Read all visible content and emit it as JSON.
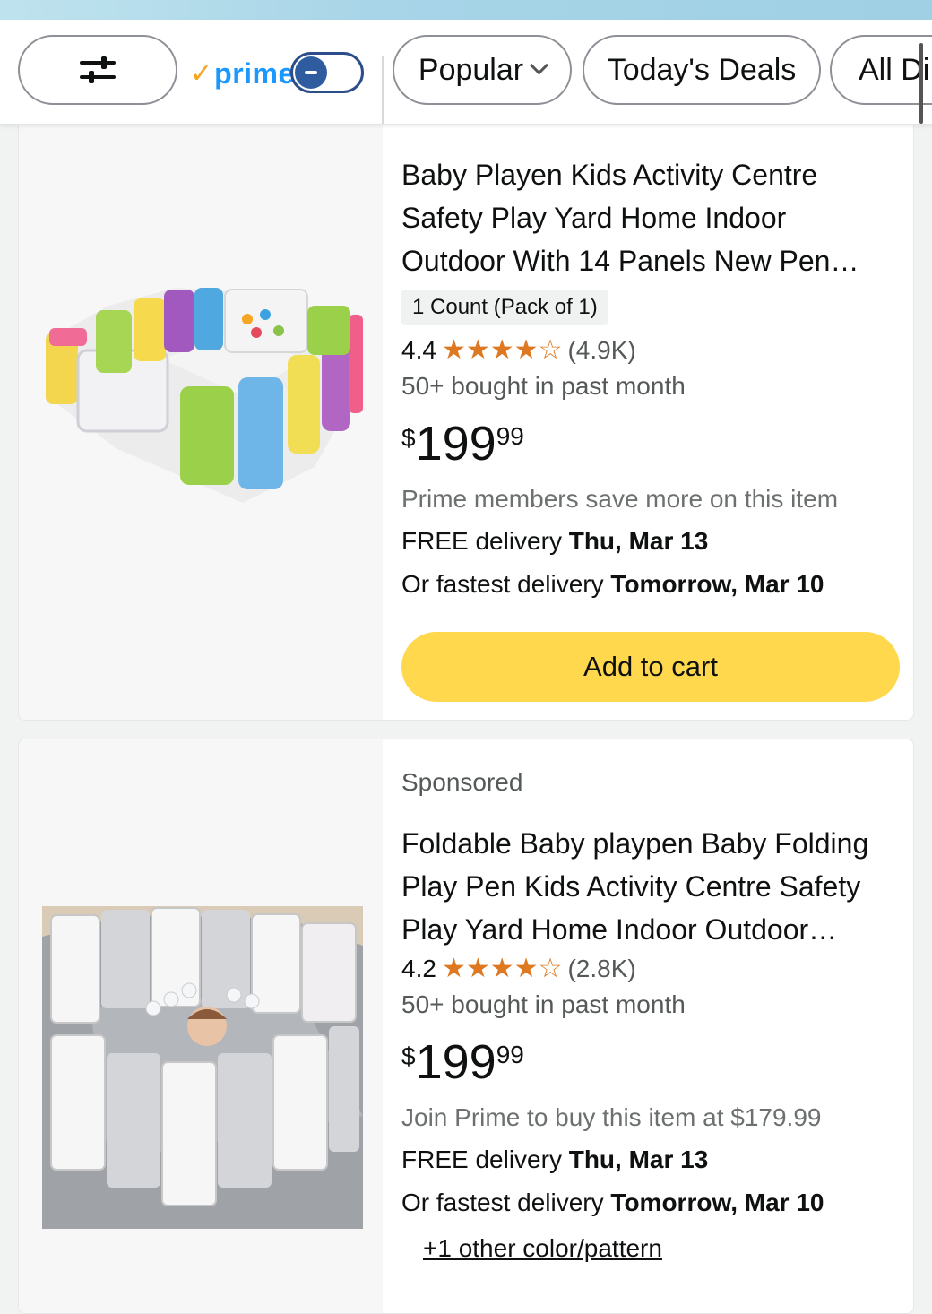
{
  "filterbar": {
    "prime_label": "prime",
    "prime_check": "✓",
    "sort_label": "Popular",
    "deals_label": "Today's Deals",
    "all_label": "All Di"
  },
  "products": [
    {
      "title_line1": "Baby Playen Kids Activity Centre",
      "title_line2": "Safety Play Yard Home Indoor",
      "title_line3": "Outdoor With 14 Panels New Pen…",
      "badge": "1 Count (Pack of 1)",
      "rating": "4.4",
      "stars": 4.4,
      "reviews": "(4.9K)",
      "bought": "50+ bought in past month",
      "price_symbol": "$",
      "price_whole": "199",
      "price_fraction": "99",
      "prime_note": "Prime members save more on this item",
      "delivery_prefix": "FREE delivery",
      "delivery_date": "Thu, Mar 13",
      "fastest_prefix": "Or fastest delivery",
      "fastest_date": "Tomorrow, Mar 10",
      "cart_label": "Add to cart"
    },
    {
      "sponsored": "Sponsored",
      "title_line1": "Foldable Baby playpen Baby Folding",
      "title_line2": "Play Pen Kids Activity Centre Safety",
      "title_line3": "Play Yard Home Indoor Outdoor…",
      "rating": "4.2",
      "stars": 4.2,
      "reviews": "(2.8K)",
      "bought": "50+ bought in past month",
      "price_symbol": "$",
      "price_whole": "199",
      "price_fraction": "99",
      "prime_note": "Join Prime to buy this item at $179.99",
      "delivery_prefix": "FREE delivery",
      "delivery_date": "Thu, Mar 13",
      "fastest_prefix": "Or fastest delivery",
      "fastest_date": "Tomorrow, Mar 10",
      "variant_link": "+1 other color/pattern"
    }
  ],
  "colors": {
    "star": "#de7921",
    "cart_button": "#ffd84d",
    "prime_blue": "#1a98ff",
    "prime_check": "#f7a31c"
  }
}
